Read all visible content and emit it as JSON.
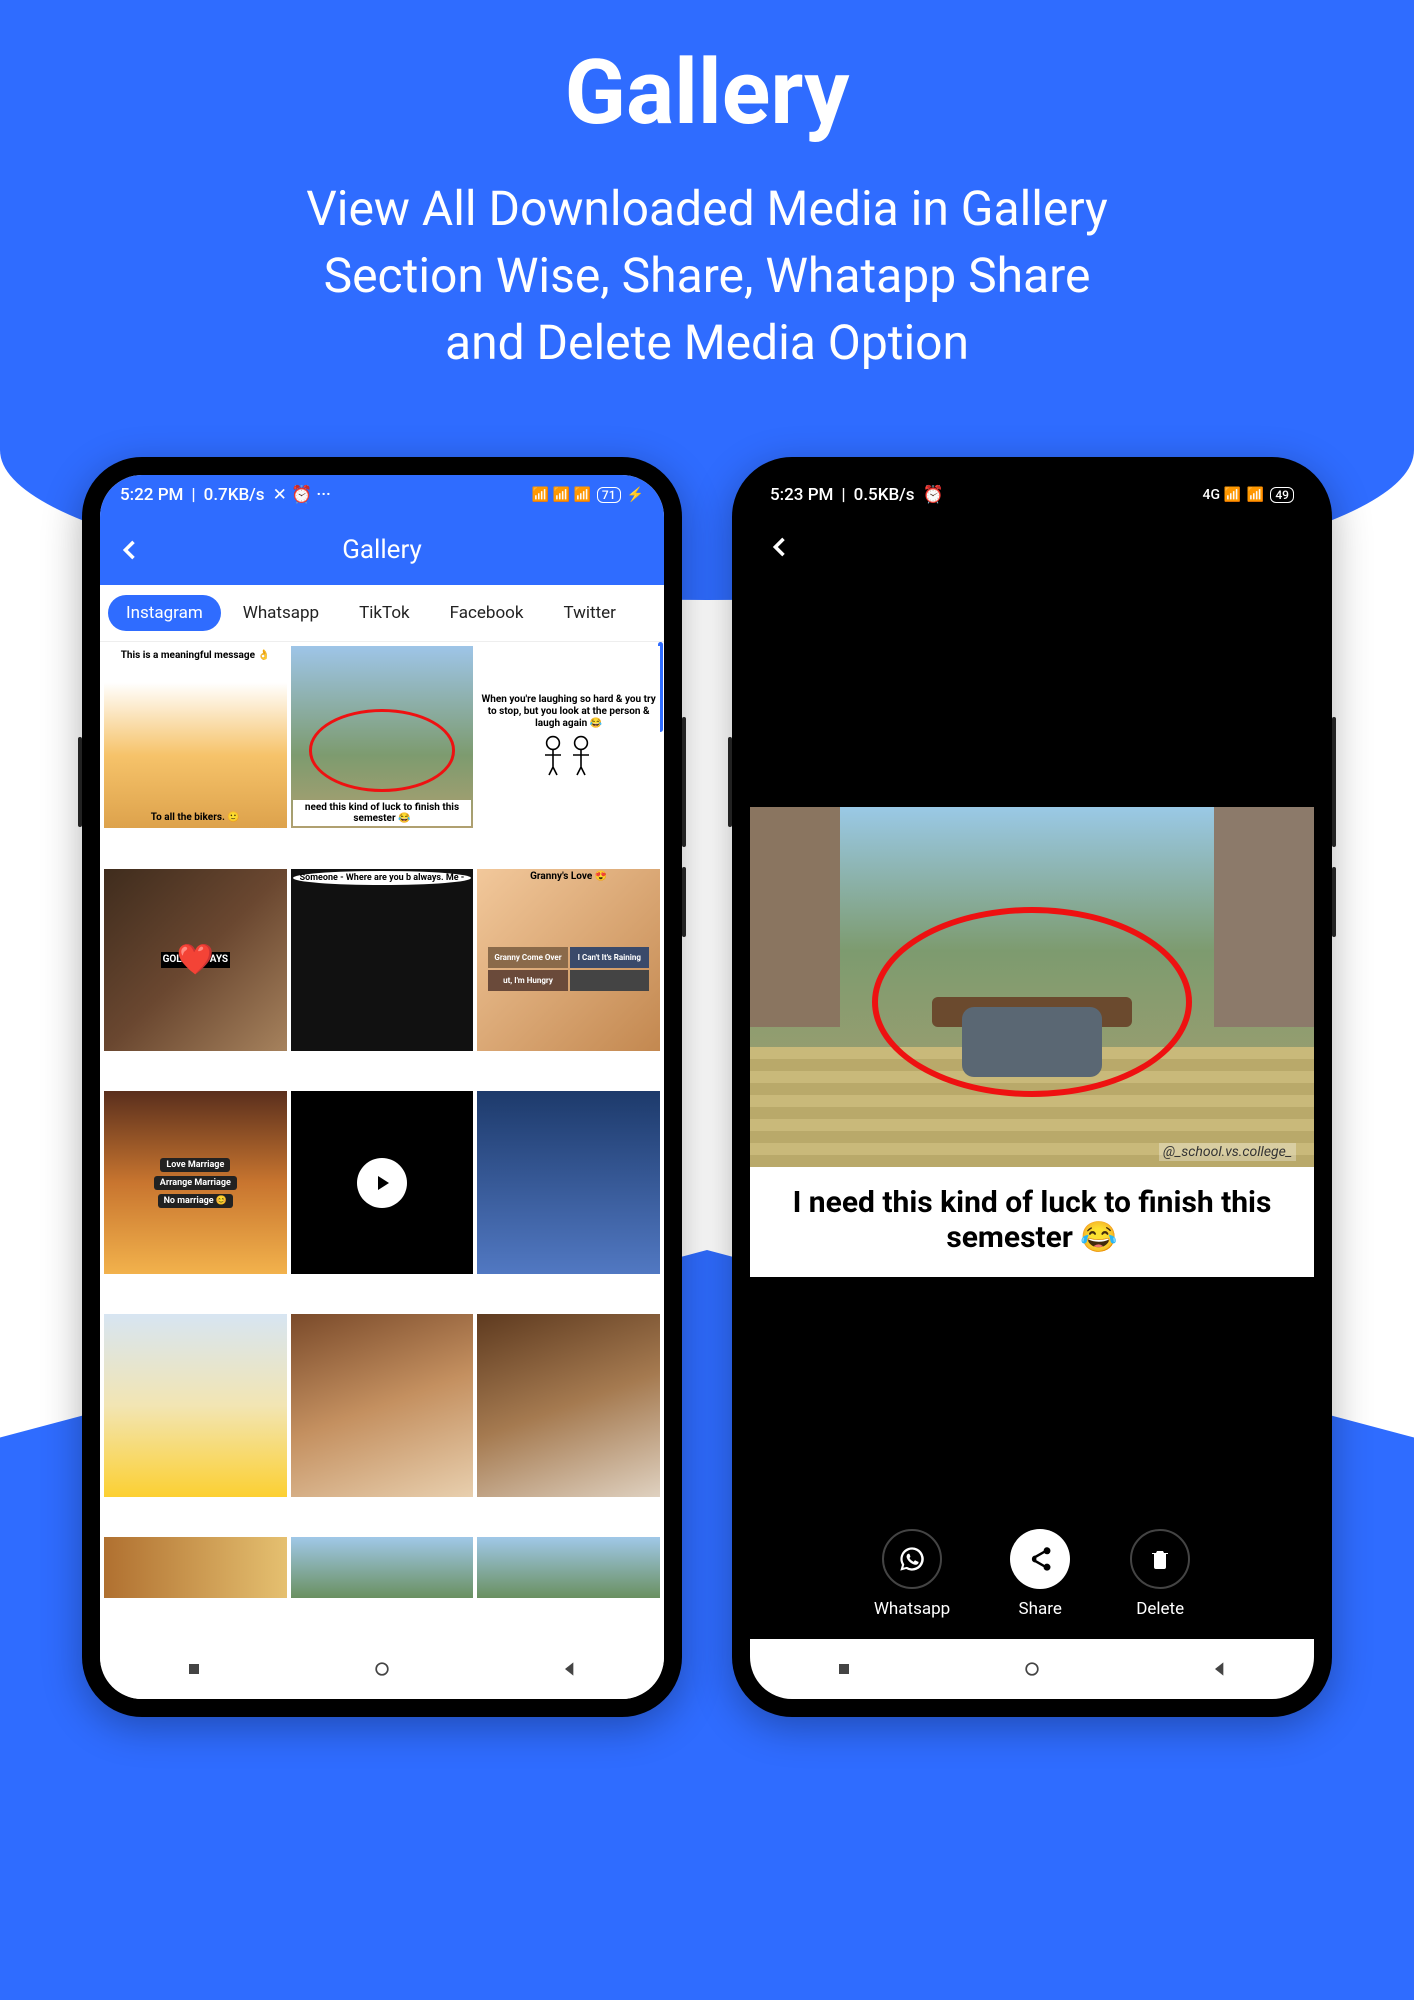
{
  "header": {
    "title": "Gallery",
    "subtitle_line1": "View  All Downloaded Media in Gallery",
    "subtitle_line2": "Section Wise, Share, Whatapp Share",
    "subtitle_line3": "and Delete Media Option"
  },
  "phone1": {
    "status": {
      "time": "5:22 PM",
      "speed": "0.7KB/s",
      "icons": "✕ ⏰ ···",
      "signal": "📶",
      "battery": "71"
    },
    "appbar_title": "Gallery",
    "tabs": [
      "Instagram",
      "Whatsapp",
      "TikTok",
      "Facebook",
      "Twitter"
    ],
    "active_tab": 0,
    "thumbs": [
      {
        "top": "This is a meaningful message 👌",
        "bottom": "To all the bikers. 🙂"
      },
      {
        "caption": "need this kind of luck to finish this semester 😂"
      },
      {
        "caption": "When you're laughing so hard & you try to stop, but you look at the person & laugh again 😂"
      },
      {
        "caption": "GOLDEN DAYS"
      },
      {
        "caption": "Someone - Where are you b always.\nMe -"
      },
      {
        "caption": "Granny's Love 😍",
        "sub": [
          "Granny Come Over",
          "I Can't It's Raining",
          "ut, I'm Hungry",
          ""
        ]
      },
      {
        "labels": [
          "Love Marriage",
          "Arrange Marriage",
          "No marriage 😊"
        ]
      },
      {
        "video": true
      },
      {
        "caption": ""
      },
      {
        "caption": ""
      },
      {
        "caption": ""
      },
      {
        "caption": ""
      },
      {
        "caption": ""
      },
      {
        "caption": ""
      },
      {
        "caption": ""
      }
    ]
  },
  "phone2": {
    "status": {
      "time": "5:23 PM",
      "speed": "0.5KB/s",
      "icons": "⏰",
      "signal": "4G 📶",
      "battery": "49"
    },
    "meme_text": "I need this kind of luck to finish this semester 😂",
    "watermark": "@_school.vs.college_",
    "actions": {
      "whatsapp": "Whatsapp",
      "share": "Share",
      "delete": "Delete"
    }
  }
}
